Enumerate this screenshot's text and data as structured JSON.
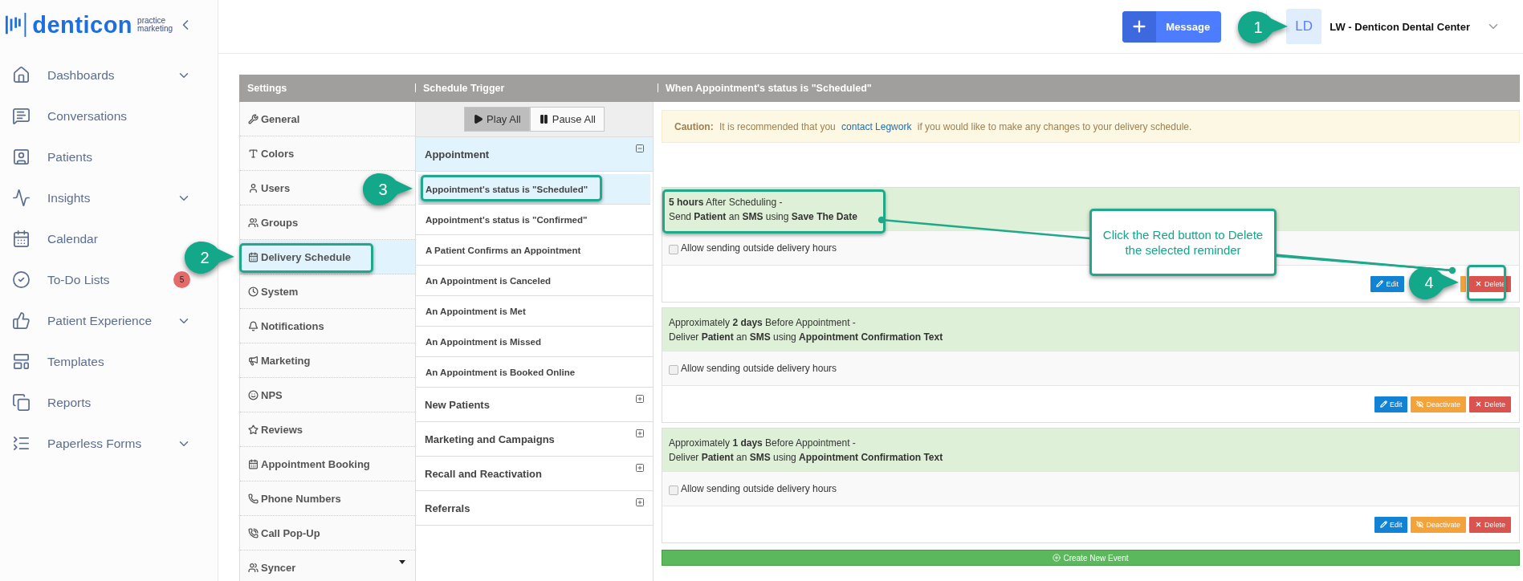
{
  "sidebar": {
    "logo": {
      "name": "denticon",
      "tagline_1": "practice",
      "tagline_2": "marketing"
    },
    "items": [
      {
        "label": "Dashboards",
        "expandable": true
      },
      {
        "label": "Conversations",
        "expandable": false
      },
      {
        "label": "Patients",
        "expandable": false
      },
      {
        "label": "Insights",
        "expandable": true
      },
      {
        "label": "Calendar",
        "expandable": false
      },
      {
        "label": "To-Do Lists",
        "expandable": false,
        "badge": "5"
      },
      {
        "label": "Patient Experience",
        "expandable": true
      },
      {
        "label": "Templates",
        "expandable": false
      },
      {
        "label": "Reports",
        "expandable": false
      },
      {
        "label": "Paperless Forms",
        "expandable": true
      }
    ]
  },
  "top_bar": {
    "message_button": {
      "label": "Message"
    },
    "avatar": "LD",
    "account": "LW - Denticon Dental Center",
    "callout": "1"
  },
  "headers": [
    "Settings",
    "Schedule Trigger",
    "When Appointment's status is \"Scheduled\""
  ],
  "settings": [
    {
      "label": "General",
      "selected": false,
      "dropdown": false
    },
    {
      "label": "Colors",
      "selected": false,
      "dropdown": false
    },
    {
      "label": "Users",
      "selected": false,
      "dropdown": false
    },
    {
      "label": "Groups",
      "selected": false,
      "dropdown": false
    },
    {
      "label": "Delivery Schedule",
      "selected": true,
      "dropdown": false,
      "callout": "2"
    },
    {
      "label": "System",
      "selected": false,
      "dropdown": false
    },
    {
      "label": "Notifications",
      "selected": false,
      "dropdown": false
    },
    {
      "label": "Marketing",
      "selected": false,
      "dropdown": false
    },
    {
      "label": "NPS",
      "selected": false,
      "dropdown": false
    },
    {
      "label": "Reviews",
      "selected": false,
      "dropdown": false
    },
    {
      "label": "Appointment Booking",
      "selected": false,
      "dropdown": false
    },
    {
      "label": "Phone Numbers",
      "selected": false,
      "dropdown": false
    },
    {
      "label": "Call Pop-Up",
      "selected": false,
      "dropdown": false
    },
    {
      "label": "Syncer",
      "selected": false,
      "dropdown": true
    }
  ],
  "play_controls": [
    {
      "label": "Play All",
      "selected": true
    },
    {
      "label": "Pause All",
      "selected": false
    }
  ],
  "triggers": [
    {
      "label": "Appointment",
      "expanded": true,
      "children": [
        {
          "label": "Appointment's status is \"Scheduled\"",
          "selected": true,
          "callout": "3"
        },
        {
          "label": "Appointment's status is \"Confirmed\"",
          "selected": false
        },
        {
          "label": "A Patient Confirms an Appointment",
          "selected": false
        },
        {
          "label": "An Appointment is Canceled",
          "selected": false
        },
        {
          "label": "An Appointment is Met",
          "selected": false
        },
        {
          "label": "An Appointment is Missed",
          "selected": false
        },
        {
          "label": "An Appointment is Booked Online",
          "selected": false
        }
      ]
    },
    {
      "label": "New Patients",
      "expanded": false
    },
    {
      "label": "Marketing and Campaigns",
      "expanded": false
    },
    {
      "label": "Recall and Reactivation",
      "expanded": false
    },
    {
      "label": "Referrals",
      "expanded": false
    }
  ],
  "caution": {
    "label": "Caution:",
    "before": "It is recommended that you",
    "link": "contact Legwork",
    "after": "if you would like to make any changes to your delivery schedule."
  },
  "events": [
    {
      "lines": [
        "**5 hours** After Scheduling -",
        "Send **Patient** an **SMS** using **Save The Date**"
      ],
      "note": "Click the Red button to Delete the selected reminder",
      "option": {
        "label": "Allow sending outside delivery hours",
        "checked": false
      },
      "buttons": [
        {
          "kind": "edit",
          "label": "Edit"
        },
        {
          "kind": "deactivate"
        },
        {
          "kind": "delete",
          "label": "Delete",
          "callout": "4"
        }
      ]
    },
    {
      "lines": [
        "Approximately **2 days** Before Appointment -",
        "Deliver **Patient** an **SMS** using **Appointment Confirmation Text**"
      ],
      "option": {
        "label": "Allow sending outside delivery hours",
        "checked": false
      },
      "buttons": [
        {
          "kind": "edit",
          "label": "Edit"
        },
        {
          "kind": "deactivate",
          "label": "Deactivate"
        },
        {
          "kind": "delete",
          "label": "Delete"
        }
      ]
    },
    {
      "lines": [
        "Approximately **1 days** Before Appointment -",
        "Deliver **Patient** an **SMS** using **Appointment Confirmation Text**"
      ],
      "option": {
        "label": "Allow sending outside delivery hours",
        "checked": false
      },
      "buttons": [
        {
          "kind": "edit",
          "label": "Edit"
        },
        {
          "kind": "deactivate",
          "label": "Deactivate"
        },
        {
          "kind": "delete",
          "label": "Delete"
        }
      ]
    }
  ],
  "create_button": {
    "label": "Create New Event"
  }
}
